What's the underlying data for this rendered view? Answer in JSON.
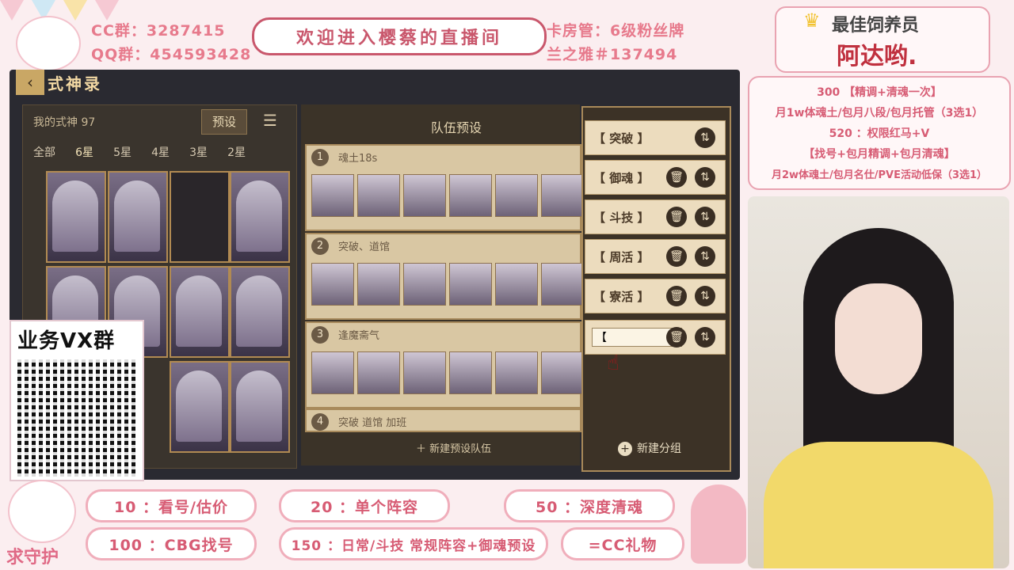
{
  "overlay": {
    "cc_group": "CC群：3287415",
    "qq_group": "QQ群：454593428",
    "banner": "欢迎进入樱蔡的直播间",
    "card_manager": "卡房管：6级粉丝牌",
    "lan_zhiya": "兰之雅＃137494",
    "best_feeder_title": "最佳饲养员",
    "best_feeder_name": "阿达哟.",
    "price_line1": "300 【精调+清魂一次】",
    "price_line2": "月1w体魂土/包月八段/包月托管（3选1）",
    "price_line3": "520 ：权限红马+V",
    "price_line4": "【找号+包月精调+包月清魂】",
    "price_line5": "月2w体魂土/包月名仕/PVE活动低保（3选1）",
    "qr_title": "业务VX群",
    "guard_text": "求守护"
  },
  "bottom_pills": [
    {
      "label": "10 ：看号/估价"
    },
    {
      "label": "20 ：单个阵容"
    },
    {
      "label": "50 ：深度清魂"
    },
    {
      "label": "100 ：CBG找号"
    },
    {
      "label": "150 ：日常/斗技 常规阵容+御魂预设"
    },
    {
      "label": "=CC礼物"
    }
  ],
  "game": {
    "title": "式神录",
    "my_shikigami": "我的式神 97",
    "preset_btn": "预设",
    "tabs": [
      "全部",
      "6星",
      "5星",
      "4星",
      "3星",
      "2星"
    ],
    "team_preset_title": "队伍预设",
    "teams": [
      {
        "num": "1",
        "name": "魂土18s"
      },
      {
        "num": "2",
        "name": "突破、道馆"
      },
      {
        "num": "3",
        "name": "逢魔斋气"
      },
      {
        "num": "4",
        "name": "突破 道馆 加班"
      }
    ],
    "new_preset": "＋ 新建预设队伍",
    "groups": [
      {
        "label": "【 突破 】"
      },
      {
        "label": "【 御魂 】"
      },
      {
        "label": "【 斗技 】"
      },
      {
        "label": "【 周活 】"
      },
      {
        "label": "【 寮活 】"
      }
    ],
    "group_input_value": "【",
    "new_group": "新建分组"
  },
  "colors": {
    "accent_pink": "#e77a8c",
    "game_gold": "#b18a52"
  }
}
